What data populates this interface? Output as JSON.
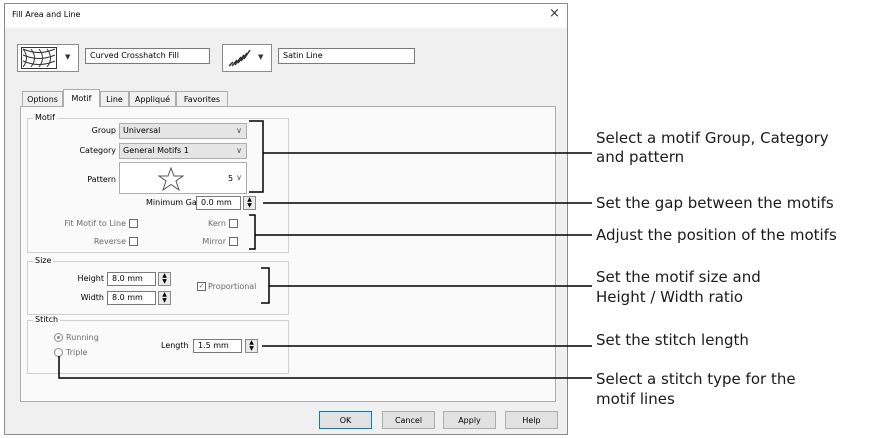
{
  "dialog": {
    "title": "Fill Area and Line",
    "close": "×",
    "fill_name": "Curved Crosshatch Fill",
    "line_name": "Satin Line"
  },
  "tabs": [
    "Options",
    "Motif",
    "Line",
    "Appliqué",
    "Favorites"
  ],
  "motif": {
    "legend": "Motif",
    "group_label": "Group",
    "group_value": "Universal",
    "category_label": "Category",
    "category_value": "General Motifs 1",
    "pattern_label": "Pattern",
    "pattern_number": "5",
    "min_gap_label": "Minimum Gap",
    "min_gap_value": "0.0 mm",
    "fit_label": "Fit Motif to Line",
    "kern_label": "Kern",
    "reverse_label": "Reverse",
    "mirror_label": "Mirror"
  },
  "size": {
    "legend": "Size",
    "height_label": "Height",
    "height_value": "8.0 mm",
    "width_label": "Width",
    "width_value": "8.0 mm",
    "proportional_label": "Proportional",
    "proportional_checked": true
  },
  "stitch": {
    "legend": "Stitch",
    "running_label": "Running",
    "triple_label": "Triple",
    "length_label": "Length",
    "length_value": "1.5 mm"
  },
  "buttons": {
    "ok": "OK",
    "cancel": "Cancel",
    "apply": "Apply",
    "help": "Help"
  },
  "callouts": {
    "c1a": "Select a motif Group, Category",
    "c1b": "and pattern",
    "c2": "Set the gap between the motifs",
    "c3": "Adjust the position of the motifs",
    "c4a": "Set the motif size and",
    "c4b": "Height / Width ratio",
    "c5": "Set the stitch length",
    "c6a": "Select a stitch type for the",
    "c6b": "motif lines"
  }
}
